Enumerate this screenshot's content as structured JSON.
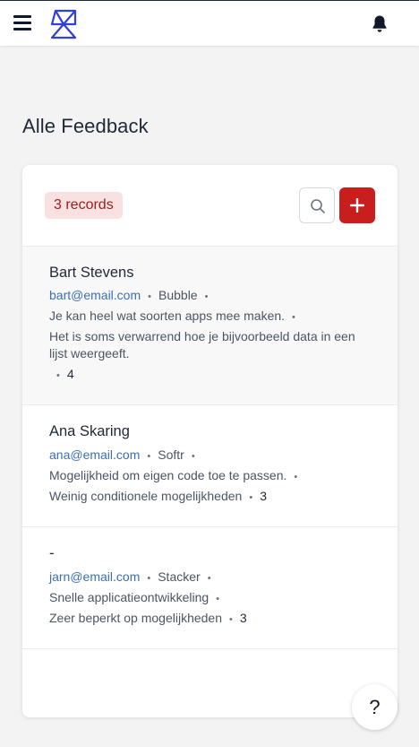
{
  "page": {
    "title": "Alle Feedback"
  },
  "header": {
    "menu_icon": "hamburger-menu-icon",
    "logo_icon": "app-logo-icon",
    "bell_icon": "bell-icon"
  },
  "list": {
    "records_label": "3 records",
    "search_icon": "search-icon",
    "add_icon": "plus-icon",
    "items": [
      {
        "name": "Bart Stevens",
        "email": "bart@email.com",
        "tool": "Bubble",
        "positive": "Je kan heel wat soorten apps mee maken.",
        "negative": "Het is soms verwarrend hoe je bijvoorbeeld data in een lijst weergeeft.",
        "score": "4"
      },
      {
        "name": "Ana Skaring",
        "email": "ana@email.com",
        "tool": "Softr",
        "positive": "Mogelijkheid om eigen code toe te passen.",
        "negative": "Weinig conditionele mogelijkheden",
        "score": "3"
      },
      {
        "name": "-",
        "email": "jarn@email.com",
        "tool": "Stacker",
        "positive": "Snelle applicatieontwikkeling",
        "negative": "Zeer beperkt op mogelijkheden",
        "score": "3"
      }
    ]
  },
  "help": {
    "label": "?"
  },
  "colors": {
    "accent": "#c81e1e",
    "badge_bg": "#f9e1e1",
    "badge_text": "#9b1c1c",
    "link": "#3b6fb6"
  }
}
